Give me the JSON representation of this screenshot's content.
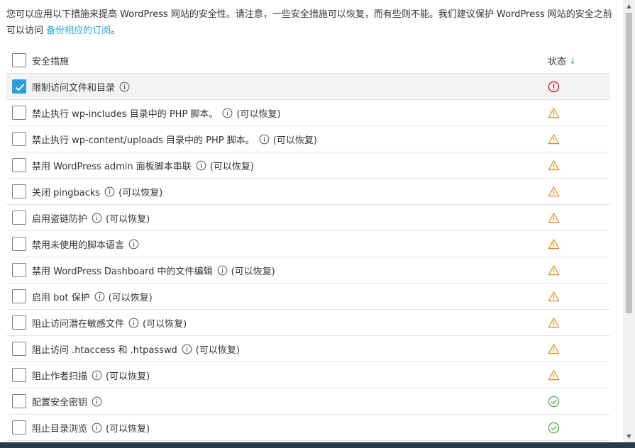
{
  "intro": {
    "text": "您可以应用以下措施来提高 WordPress 网站的安全性。请注意，一些安全措施可以恢复，而有些则不能。我们建议保护 WordPress 网站的安全之前可以访问 ",
    "link": "备份相应的订阅",
    "suffix": "。"
  },
  "table": {
    "header_label": "安全措施",
    "status_label": "状态",
    "sort_arrow": "↓"
  },
  "reversible_text": "(可以恢复)",
  "colors": {
    "accent": "#2a9fd8",
    "error": "#d0021b",
    "warning": "#e08a1e",
    "ok": "#3eb23e"
  },
  "rows": [
    {
      "label": "限制访问文件和目录",
      "reversible": false,
      "checked": true,
      "status": "error"
    },
    {
      "label": "禁止执行 wp-includes 目录中的 PHP 脚本。",
      "reversible": true,
      "checked": false,
      "status": "warning"
    },
    {
      "label": "禁止执行 wp-content/uploads 目录中的 PHP 脚本。",
      "reversible": true,
      "checked": false,
      "status": "warning"
    },
    {
      "label": "禁用 WordPress admin 面板脚本串联",
      "reversible": true,
      "checked": false,
      "status": "warning"
    },
    {
      "label": "关闭 pingbacks",
      "reversible": true,
      "checked": false,
      "status": "warning"
    },
    {
      "label": "启用盗链防护",
      "reversible": true,
      "checked": false,
      "status": "warning"
    },
    {
      "label": "禁用未使用的脚本语言",
      "reversible": false,
      "checked": false,
      "status": "warning"
    },
    {
      "label": "禁用 WordPress Dashboard 中的文件编辑",
      "reversible": true,
      "checked": false,
      "status": "warning"
    },
    {
      "label": "启用 bot 保护",
      "reversible": true,
      "checked": false,
      "status": "warning"
    },
    {
      "label": "阻止访问潜在敏感文件",
      "reversible": true,
      "checked": false,
      "status": "warning"
    },
    {
      "label": "阻止访问 .htaccess 和 .htpasswd",
      "reversible": true,
      "checked": false,
      "status": "warning"
    },
    {
      "label": "阻止作者扫描",
      "reversible": true,
      "checked": false,
      "status": "warning"
    },
    {
      "label": "配置安全密钥",
      "reversible": false,
      "checked": false,
      "status": "ok"
    },
    {
      "label": "阻止目录浏览",
      "reversible": true,
      "checked": false,
      "status": "ok"
    }
  ]
}
